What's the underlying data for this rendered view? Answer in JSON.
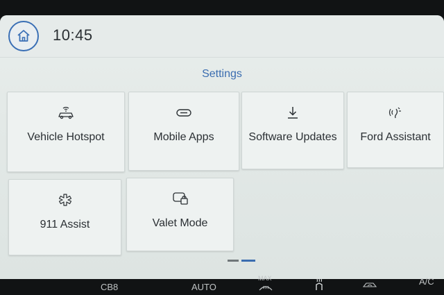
{
  "status_bar": {
    "time": "10:45",
    "home_icon": "home-icon"
  },
  "page": {
    "title": "Settings"
  },
  "tiles": [
    {
      "label": "Vehicle Hotspot",
      "icon": "car-wifi-icon"
    },
    {
      "label": "Mobile Apps",
      "icon": "link-icon"
    },
    {
      "label": "Software Updates",
      "icon": "download-icon"
    },
    {
      "label": "Ford Assistant",
      "icon": "voice-assistant-icon"
    },
    {
      "label": "911 Assist",
      "icon": "emergency-star-icon"
    },
    {
      "label": "Valet Mode",
      "icon": "valet-lock-icon"
    }
  ],
  "pager": {
    "current_page": 2,
    "total_pages": 2
  },
  "climate_bar": {
    "left_text": "CB8",
    "auto_label": "AUTO",
    "max_label": "MAX",
    "ac_label": "A/C"
  },
  "colors": {
    "accent": "#3b6db0",
    "text": "#2a2f33",
    "tile_bg": "#eef2f1"
  }
}
